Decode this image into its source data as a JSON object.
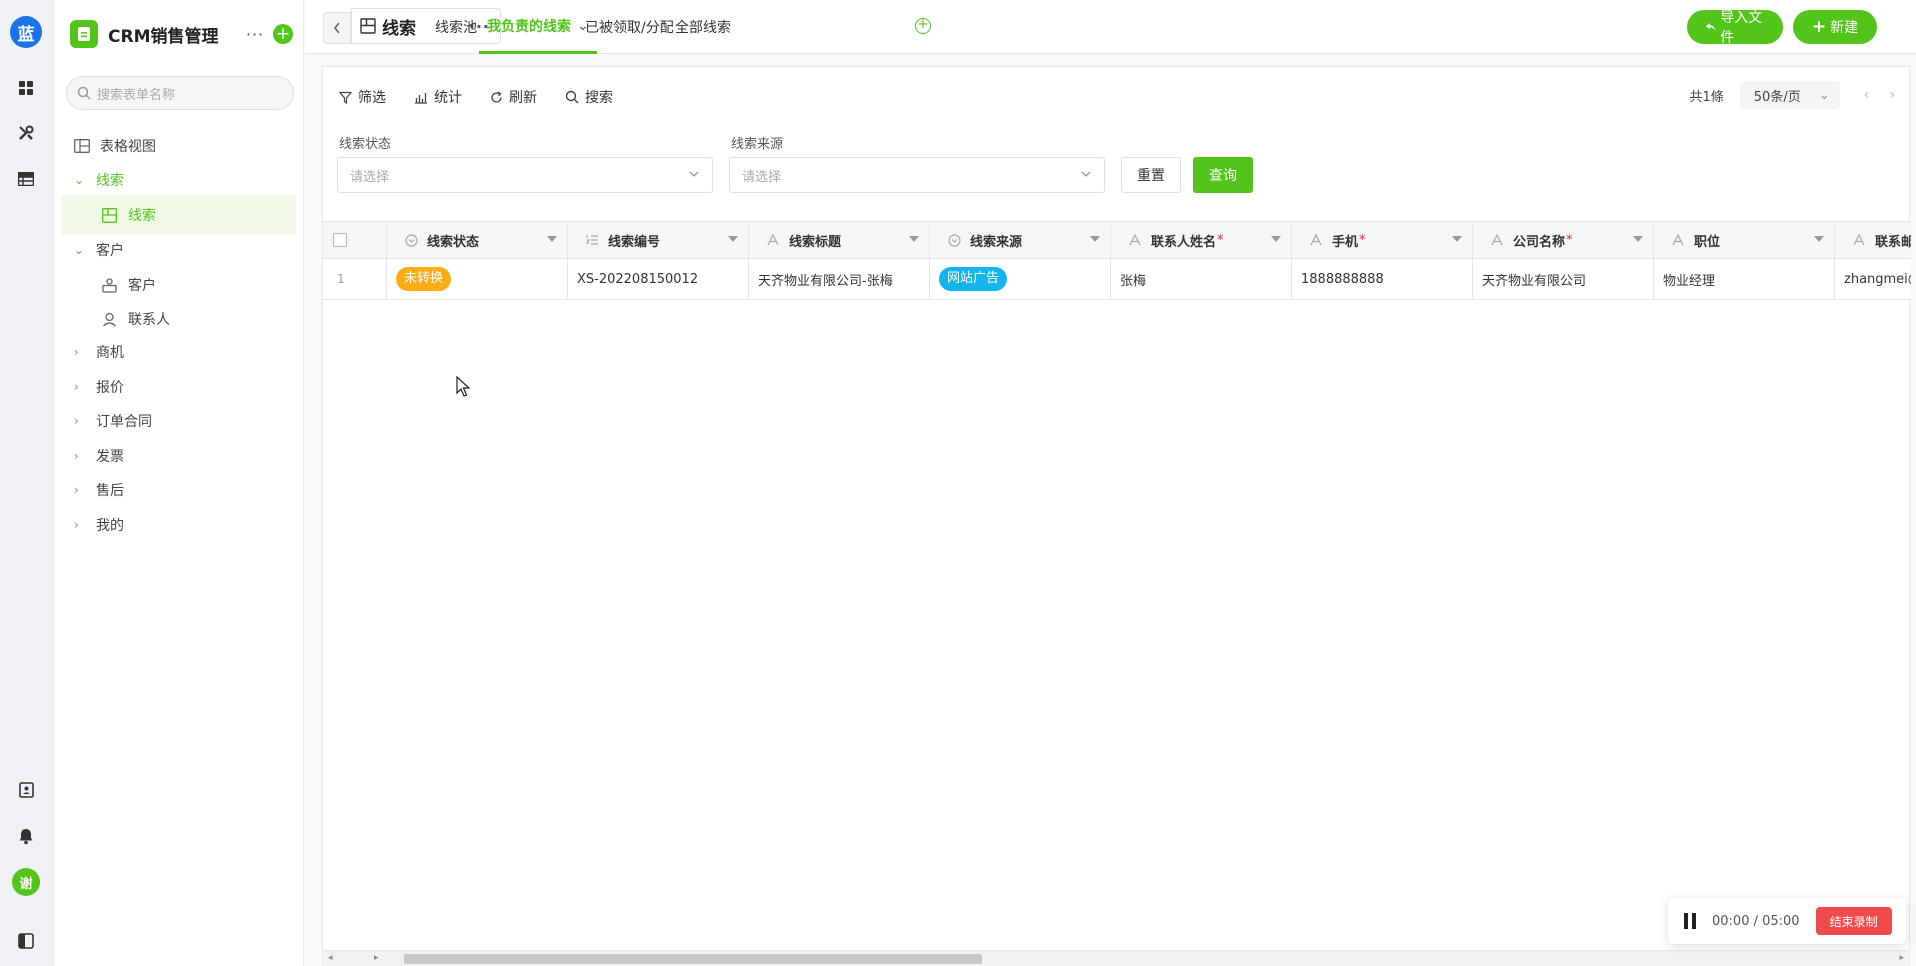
{
  "rail": {
    "logo_text": "蓝",
    "avatar_text": "谢",
    "icons": [
      "grid-icon",
      "tools-icon",
      "table-icon",
      "contacts-book-icon",
      "bell-icon",
      "sidebar-toggle-icon"
    ]
  },
  "sidebar": {
    "app_title": "CRM销售管理",
    "search_placeholder": "搜索表单名称",
    "view_label": "表格视图",
    "groups": [
      {
        "label": "线索",
        "open": true,
        "children": [
          "线索"
        ]
      },
      {
        "label": "客户",
        "open": true,
        "children": [
          "客户",
          "联系人"
        ]
      },
      {
        "label": "商机",
        "open": false
      },
      {
        "label": "报价",
        "open": false
      },
      {
        "label": "订单合同",
        "open": false
      },
      {
        "label": "发票",
        "open": false
      },
      {
        "label": "售后",
        "open": false
      },
      {
        "label": "我的",
        "open": false
      }
    ]
  },
  "topbar": {
    "view_title": "线索",
    "tabs": [
      "线索池",
      "我负责的线索",
      "已被领取/分配",
      "全部线索"
    ],
    "active_tab": "我负责的线索",
    "import_label": "导入文件",
    "new_label": "新建"
  },
  "toolbar": {
    "filter": "筛选",
    "stats": "统计",
    "refresh": "刷新",
    "search": "搜索",
    "total": "共1條",
    "page_size": "50条/页"
  },
  "filters": {
    "status_label": "线索状态",
    "status_placeholder": "请选择",
    "source_label": "线索来源",
    "source_placeholder": "请选择",
    "reset": "重置",
    "query": "查询"
  },
  "table": {
    "columns": [
      {
        "label": "线索状态",
        "required": false
      },
      {
        "label": "线索编号",
        "required": false
      },
      {
        "label": "线索标题",
        "required": false
      },
      {
        "label": "线索来源",
        "required": false
      },
      {
        "label": "联系人姓名",
        "required": true
      },
      {
        "label": "手机",
        "required": true
      },
      {
        "label": "公司名称",
        "required": true
      },
      {
        "label": "职位",
        "required": false
      },
      {
        "label": "联系邮",
        "required": false
      }
    ],
    "rows": [
      {
        "index": "1",
        "status": "未转换",
        "code": "XS-202208150012",
        "title": "天齐物业有限公司-张梅",
        "source": "网站广告",
        "contact": "张梅",
        "phone": "1888888888",
        "company": "天齐物业有限公司",
        "position": "物业经理",
        "email": "zhangmei@"
      }
    ],
    "status_color": "#faad14",
    "source_color": "#13b5ea"
  },
  "recorder": {
    "time": "00:00 / 05:00",
    "stop_label": "结束录制"
  },
  "colors": {
    "accent": "#52c41a",
    "brand": "#1a73e8",
    "danger": "#f04a4a"
  }
}
